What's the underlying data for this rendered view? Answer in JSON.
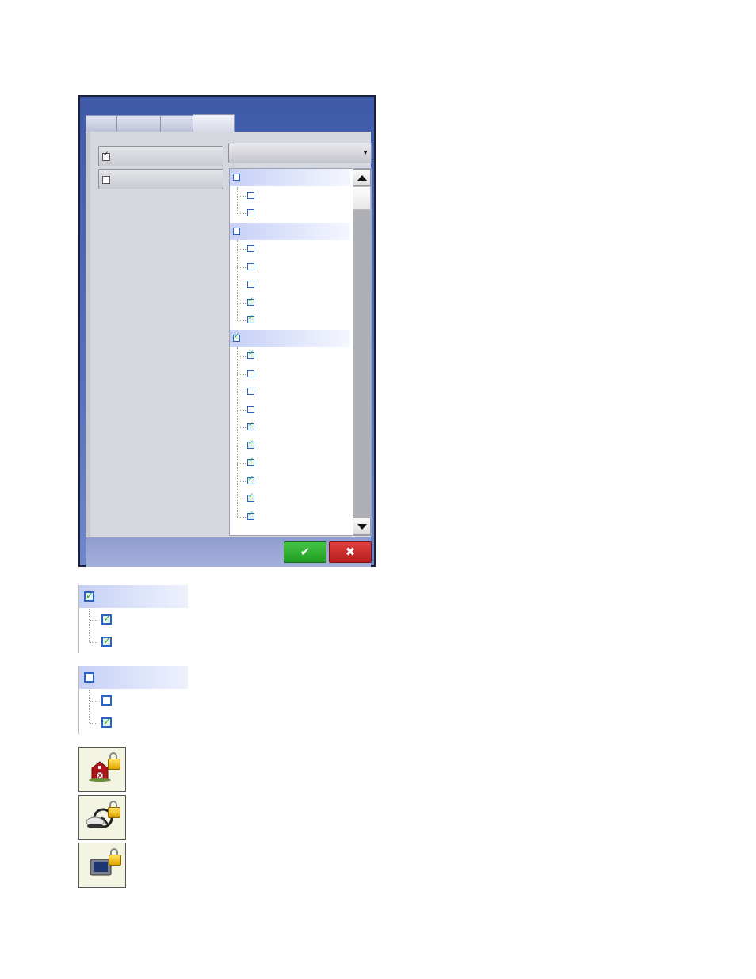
{
  "window": {
    "tabs": [
      "",
      "",
      "",
      ""
    ],
    "active_tab": 3
  },
  "options": [
    {
      "label": "",
      "checked": true
    },
    {
      "label": "",
      "checked": false
    }
  ],
  "dropdown": {
    "value": ""
  },
  "list_rows": [
    {
      "level": 0,
      "checked": false
    },
    {
      "level": 1,
      "checked": false
    },
    {
      "level": 1,
      "checked": false
    },
    {
      "level": 0,
      "checked": false
    },
    {
      "level": 1,
      "checked": false
    },
    {
      "level": 1,
      "checked": false
    },
    {
      "level": 1,
      "checked": false
    },
    {
      "level": 1,
      "checked": true
    },
    {
      "level": 1,
      "checked": true
    },
    {
      "level": 0,
      "checked": true
    },
    {
      "level": 1,
      "checked": true
    },
    {
      "level": 1,
      "checked": false
    },
    {
      "level": 1,
      "checked": false
    },
    {
      "level": 1,
      "checked": false
    },
    {
      "level": 1,
      "checked": true
    },
    {
      "level": 1,
      "checked": true
    },
    {
      "level": 1,
      "checked": true
    },
    {
      "level": 1,
      "checked": true
    },
    {
      "level": 1,
      "checked": true
    },
    {
      "level": 1,
      "checked": true
    }
  ],
  "buttons": {
    "ok_label": "✔",
    "cancel_label": "✖"
  },
  "examples": [
    {
      "parent_checked": true,
      "children_checked": [
        true,
        true
      ]
    },
    {
      "parent_checked": false,
      "children_checked": [
        false,
        true
      ]
    }
  ],
  "lock_icons": [
    "farm-lock-icon",
    "gps-steering-lock-icon",
    "display-lock-icon"
  ],
  "colors": {
    "accent_blue": "#3f5aa8",
    "ok_green": "#2aa82c",
    "cancel_red": "#c42a28",
    "check_green": "#2da531"
  }
}
